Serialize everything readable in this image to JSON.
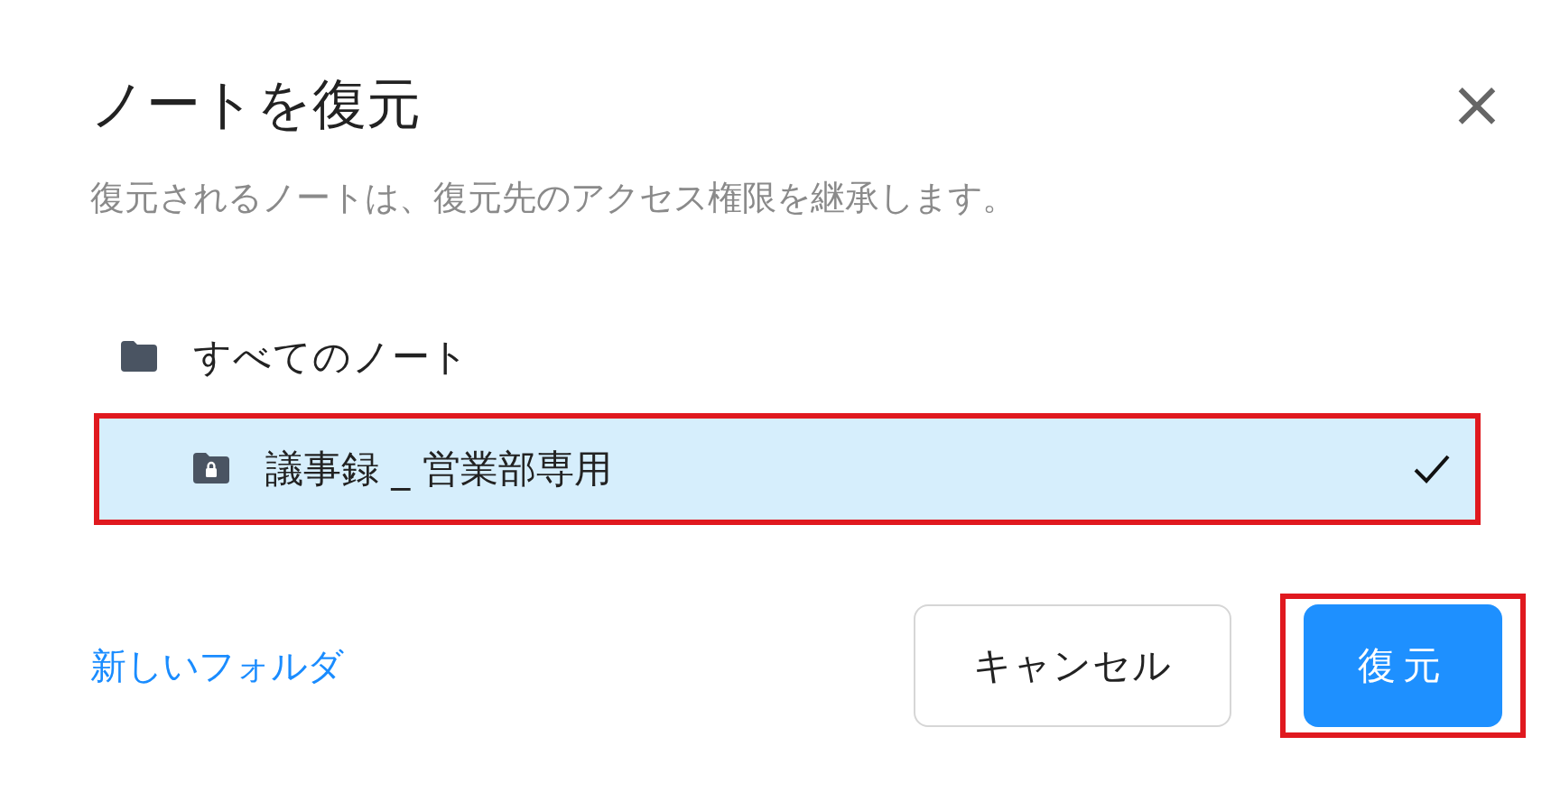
{
  "dialog": {
    "title": "ノートを復元",
    "close": "×",
    "description": "復元されるノートは、復元先のアクセス権限を継承します。"
  },
  "tree": [
    {
      "label": "すべてのノート",
      "locked": false,
      "selected": false,
      "highlighted": false,
      "children": [
        {
          "label": "議事録 _ 営業部専用",
          "locked": true,
          "selected": true,
          "highlighted": true
        }
      ]
    }
  ],
  "new_folder_link": "新しいフォルダ",
  "buttons": [
    {
      "label": "キャンセル",
      "kind": "secondary",
      "highlighted": false
    },
    {
      "label": "復元",
      "kind": "primary",
      "highlighted": true
    }
  ]
}
